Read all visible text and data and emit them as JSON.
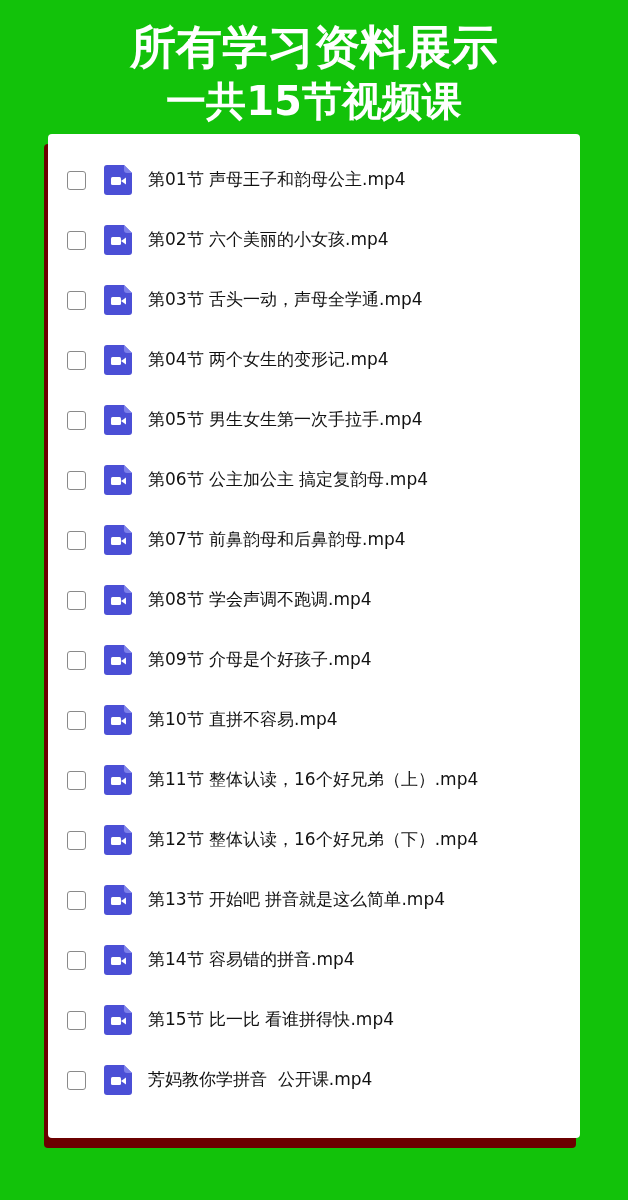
{
  "banner": {
    "title": "所有学习资料展示",
    "subtitle": "一共15节视频课"
  },
  "files": [
    {
      "name": "第01节 声母王子和韵母公主.mp4",
      "checked": false
    },
    {
      "name": "第02节 六个美丽的小女孩.mp4",
      "checked": false
    },
    {
      "name": "第03节 舌头一动，声母全学通.mp4",
      "checked": false
    },
    {
      "name": "第04节 两个女生的变形记.mp4",
      "checked": false
    },
    {
      "name": "第05节 男生女生第一次手拉手.mp4",
      "checked": false
    },
    {
      "name": "第06节 公主加公主 搞定复韵母.mp4",
      "checked": false
    },
    {
      "name": "第07节 前鼻韵母和后鼻韵母.mp4",
      "checked": false
    },
    {
      "name": "第08节 学会声调不跑调.mp4",
      "checked": false
    },
    {
      "name": "第09节 介母是个好孩子.mp4",
      "checked": false
    },
    {
      "name": "第10节 直拼不容易.mp4",
      "checked": false
    },
    {
      "name": "第11节 整体认读，16个好兄弟（上）.mp4",
      "checked": false
    },
    {
      "name": "第12节 整体认读，16个好兄弟（下）.mp4",
      "checked": false
    },
    {
      "name": "第13节 开始吧 拼音就是这么简单.mp4",
      "checked": false
    },
    {
      "name": "第14节 容易错的拼音.mp4",
      "checked": false
    },
    {
      "name": "第15节 比一比 看谁拼得快.mp4",
      "checked": false
    },
    {
      "name": "芳妈教你学拼音  公开课.mp4",
      "checked": false
    }
  ]
}
